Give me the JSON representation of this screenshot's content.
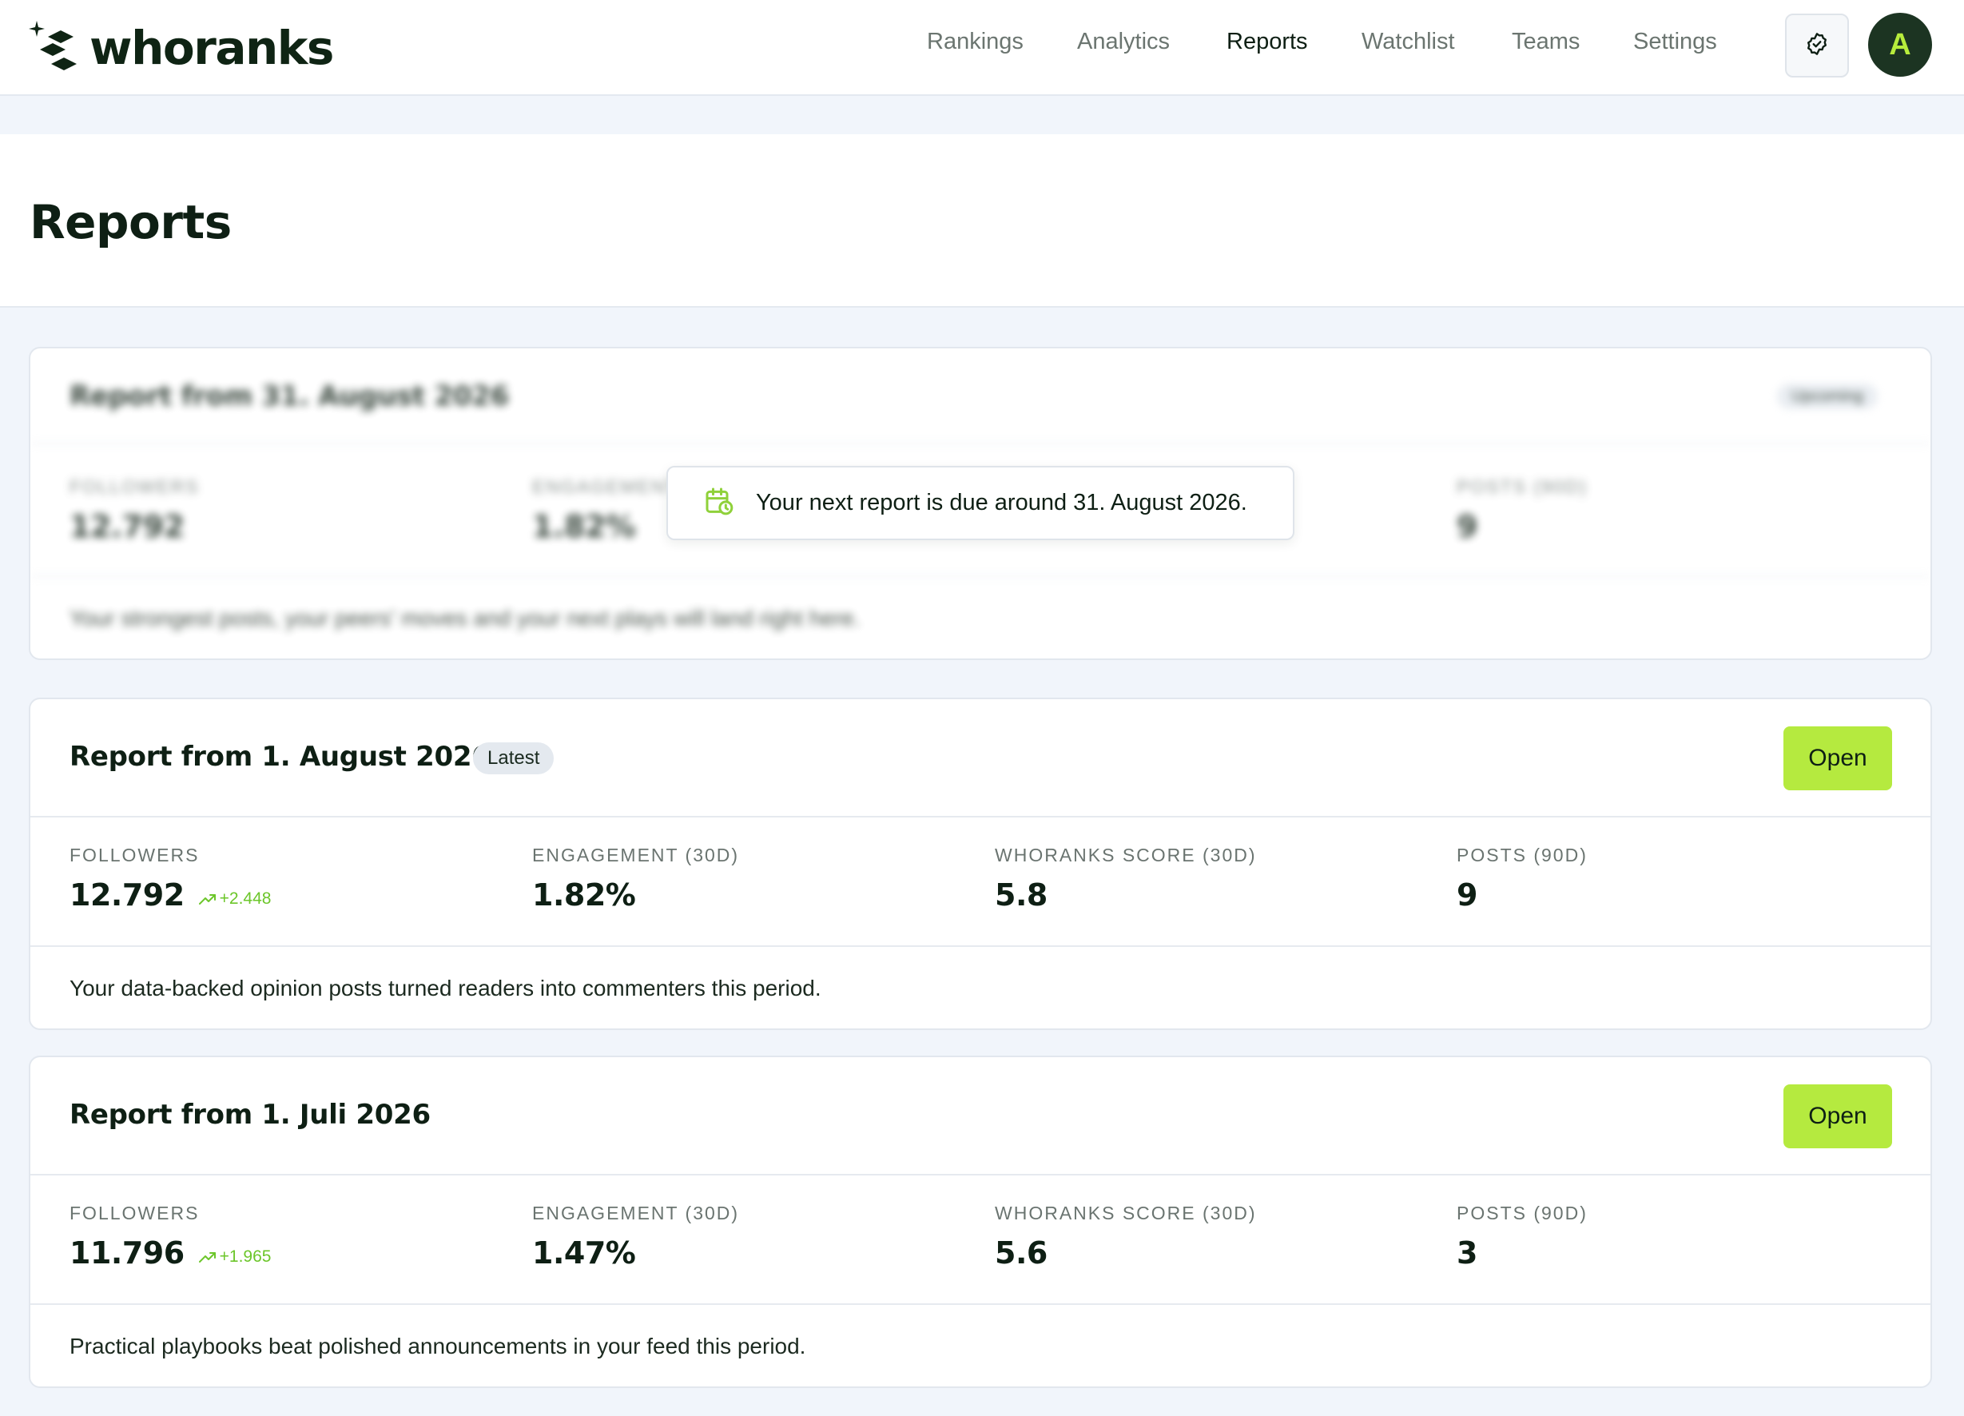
{
  "brand": {
    "name": "whoranks"
  },
  "nav": {
    "items": [
      {
        "label": "Rankings"
      },
      {
        "label": "Analytics"
      },
      {
        "label": "Reports"
      },
      {
        "label": "Watchlist"
      },
      {
        "label": "Teams"
      },
      {
        "label": "Settings"
      }
    ],
    "active": "Reports"
  },
  "user": {
    "avatar_initial": "A"
  },
  "page": {
    "title": "Reports"
  },
  "upcoming": {
    "title": "Report from 31. August 2026",
    "badge": "Upcoming",
    "metrics": [
      {
        "label": "FOLLOWERS",
        "value": "12.792"
      },
      {
        "label": "ENGAGEMENT",
        "value": "1.82%"
      },
      {
        "label": "",
        "value": ""
      },
      {
        "label": "POSTS (90D)",
        "value": "9"
      }
    ],
    "summary": "Your strongest posts, your peers' moves and your next plays will land right here.",
    "toast": "Your next report is due around 31. August 2026."
  },
  "reports": [
    {
      "title": "Report from 1. August 2026",
      "badge": "Latest",
      "open_label": "Open",
      "metrics": [
        {
          "label": "FOLLOWERS",
          "value": "12.792",
          "delta": "+2.448"
        },
        {
          "label": "ENGAGEMENT (30D)",
          "value": "1.82%"
        },
        {
          "label": "WHORANKS SCORE (30D)",
          "value": "5.8"
        },
        {
          "label": "POSTS (90D)",
          "value": "9"
        }
      ],
      "summary": "Your data-backed opinion posts turned readers into commenters this period."
    },
    {
      "title": "Report from 1. Juli 2026",
      "open_label": "Open",
      "metrics": [
        {
          "label": "FOLLOWERS",
          "value": "11.796",
          "delta": "+1.965"
        },
        {
          "label": "ENGAGEMENT (30D)",
          "value": "1.47%"
        },
        {
          "label": "WHORANKS SCORE (30D)",
          "value": "5.6"
        },
        {
          "label": "POSTS (90D)",
          "value": "3"
        }
      ],
      "summary": "Practical playbooks beat polished announcements in your feed this period."
    }
  ],
  "colors": {
    "accent": "#b5ea3f",
    "brand_dark": "#0f2414",
    "delta_green": "#6cc62a",
    "background": "#f1f5fb"
  },
  "icons": {
    "logo": "whoranks-logo-icon",
    "header_button": "badge-check-icon",
    "toast": "calendar-clock-icon",
    "delta": "trending-up-icon"
  }
}
